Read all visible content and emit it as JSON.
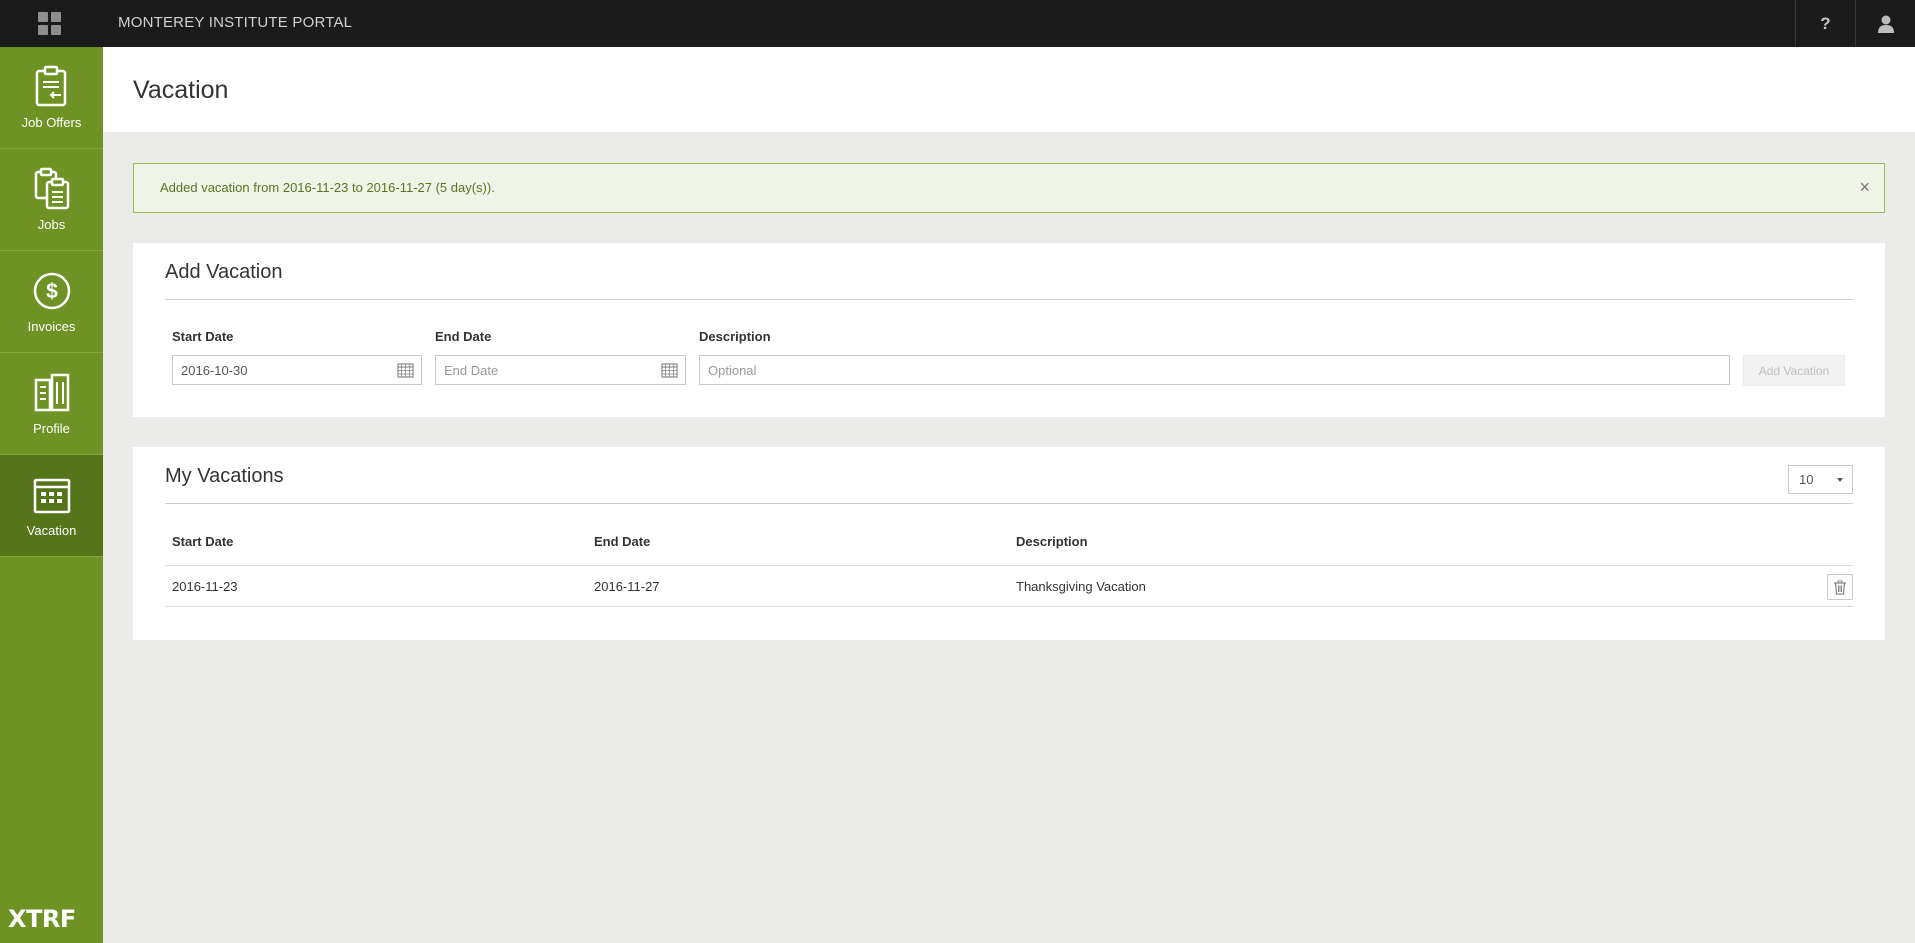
{
  "topbar": {
    "title": "MONTEREY INSTITUTE PORTAL",
    "help_label": "?"
  },
  "sidebar": {
    "items": [
      {
        "label": "Job Offers",
        "icon": "job-offers-icon"
      },
      {
        "label": "Jobs",
        "icon": "jobs-icon"
      },
      {
        "label": "Invoices",
        "icon": "dollar-circle-icon"
      },
      {
        "label": "Profile",
        "icon": "profile-icon"
      },
      {
        "label": "Vacation",
        "icon": "calendar-icon",
        "active": true
      }
    ],
    "logo": "XTRF"
  },
  "page": {
    "title": "Vacation"
  },
  "alert": {
    "message": "Added vacation from 2016-11-23 to 2016-11-27 (5 day(s)).",
    "close_glyph": "×"
  },
  "add_vacation": {
    "title": "Add Vacation",
    "start_date_label": "Start Date",
    "start_date_value": "2016-10-30",
    "end_date_label": "End Date",
    "end_date_placeholder": "End Date",
    "description_label": "Description",
    "description_placeholder": "Optional",
    "submit_label": "Add Vacation"
  },
  "my_vacations": {
    "title": "My Vacations",
    "page_size": "10",
    "columns": [
      "Start Date",
      "End Date",
      "Description"
    ],
    "rows": [
      {
        "start": "2016-11-23",
        "end": "2016-11-27",
        "description": "Thanksgiving Vacation"
      }
    ]
  },
  "colors": {
    "sidebar": "#6f9224",
    "sidebar_active": "#56741a",
    "topbar": "#1b1b1b",
    "alert_bg": "#f0f4e8",
    "alert_border": "#9dba5c"
  }
}
